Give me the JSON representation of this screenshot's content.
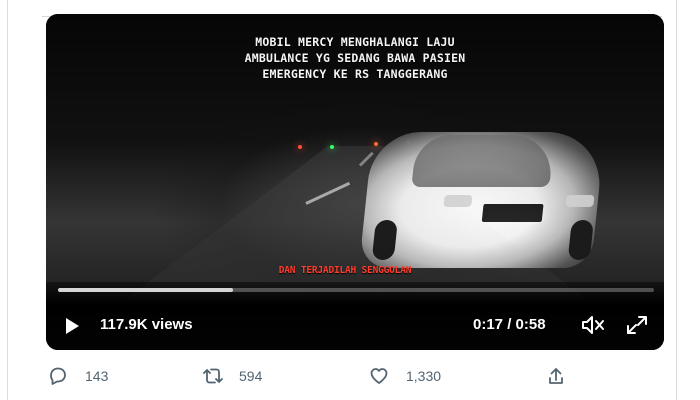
{
  "video": {
    "caption_line_1": "MOBIL MERCY MENGHALANGI LAJU",
    "caption_line_2": "AMBULANCE YG SEDANG BAWA PASIEN",
    "caption_line_3": "EMERGENCY KE RS TANGGERANG",
    "subtitle": "DAN TERJADILAH SENGGOLAN",
    "progress_fraction": 0.293,
    "views": "117.9K views",
    "current_time": "0:17",
    "time_separator": " / ",
    "duration": "0:58"
  },
  "icons": {
    "play": "play-icon",
    "volume": "speaker-muted-icon",
    "fullscreen": "expand-icon",
    "reply": "speech-bubble-icon",
    "retweet": "retweet-icon",
    "like": "heart-icon",
    "share": "upload-icon"
  },
  "actions": {
    "reply_count": "143",
    "retweet_count": "594",
    "like_count": "1,330"
  },
  "colors": {
    "video_background": "#070707",
    "overlay_text": "#f5f5f5",
    "subtitle_text": "#ff3d2e",
    "action_text": "#536471",
    "progress_fill": "#d6d6d6"
  }
}
